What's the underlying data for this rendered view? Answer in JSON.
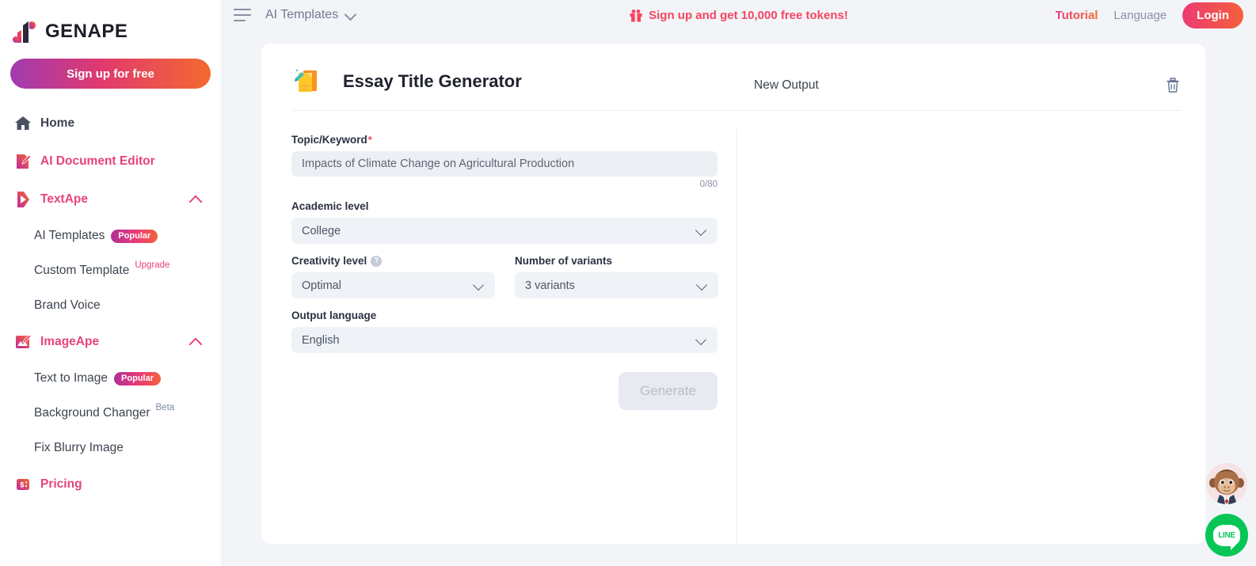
{
  "sidebar": {
    "logo_text": "GENAPE",
    "logo_icon": "genape-ape-logo-icon",
    "signup_label": "Sign up for free",
    "items": [
      {
        "label": "Home",
        "icon": "home-icon",
        "style": "dark"
      },
      {
        "label": "AI Document Editor",
        "icon": "document-edit-icon",
        "style": "pink"
      },
      {
        "label": "TextApe",
        "icon": "textape-icon",
        "style": "pink",
        "expanded": true
      }
    ],
    "textape_children": [
      {
        "label": "AI Templates",
        "badge": "Popular",
        "badge_type": "popular"
      },
      {
        "label": "Custom Template",
        "badge": "Upgrade",
        "badge_type": "upgrade"
      },
      {
        "label": "Brand Voice",
        "badge": "",
        "badge_type": ""
      }
    ],
    "imageape": {
      "label": "ImageApe",
      "icon": "image-edit-icon",
      "style": "pink",
      "expanded": true
    },
    "imageape_children": [
      {
        "label": "Text to Image",
        "badge": "Popular",
        "badge_type": "popular"
      },
      {
        "label": "Background Changer",
        "badge": "Beta",
        "badge_type": "beta"
      },
      {
        "label": "Fix Blurry Image",
        "badge": "",
        "badge_type": ""
      }
    ],
    "pricing": {
      "label": "Pricing",
      "icon": "price-tag-icon",
      "style": "pink"
    }
  },
  "topbar": {
    "menu_icon": "hamburger-menu-icon",
    "breadcrumb": "AI Templates",
    "chevron_icon": "chevron-down-icon",
    "promo_text": "Sign up and get 10,000 free tokens!",
    "promo_icon": "gift-icon",
    "tutorial_label": "Tutorial",
    "language_label": "Language",
    "login_label": "Login"
  },
  "tool": {
    "icon": "memo-pencil-icon",
    "title": "Essay Title Generator"
  },
  "form": {
    "topic": {
      "label": "Topic/Keyword",
      "required_mark": "*",
      "placeholder": "Impacts of Climate Change on Agricultural Production",
      "value": "",
      "counter": "0/80"
    },
    "academic_level": {
      "label": "Academic level",
      "value": "College"
    },
    "creativity_level": {
      "label": "Creativity level",
      "value": "Optimal",
      "help_icon": "question-mark-icon",
      "help_glyph": "?"
    },
    "variants": {
      "label": "Number of variants",
      "value": "3 variants"
    },
    "output_language": {
      "label": "Output language",
      "value": "English"
    },
    "generate_label": "Generate"
  },
  "output": {
    "title": "New Output",
    "delete_icon": "trash-icon"
  },
  "floating": {
    "avatar_icon": "ape-avatar-icon",
    "line_label": "LINE",
    "line_icon": "line-chat-icon"
  },
  "colors": {
    "accent_pink": "#e8437a",
    "accent_orange": "#f4692f",
    "promo_red": "#f4455f",
    "page_bg": "#f2f4f8",
    "input_bg": "#eceff4",
    "line_green": "#06c755"
  }
}
